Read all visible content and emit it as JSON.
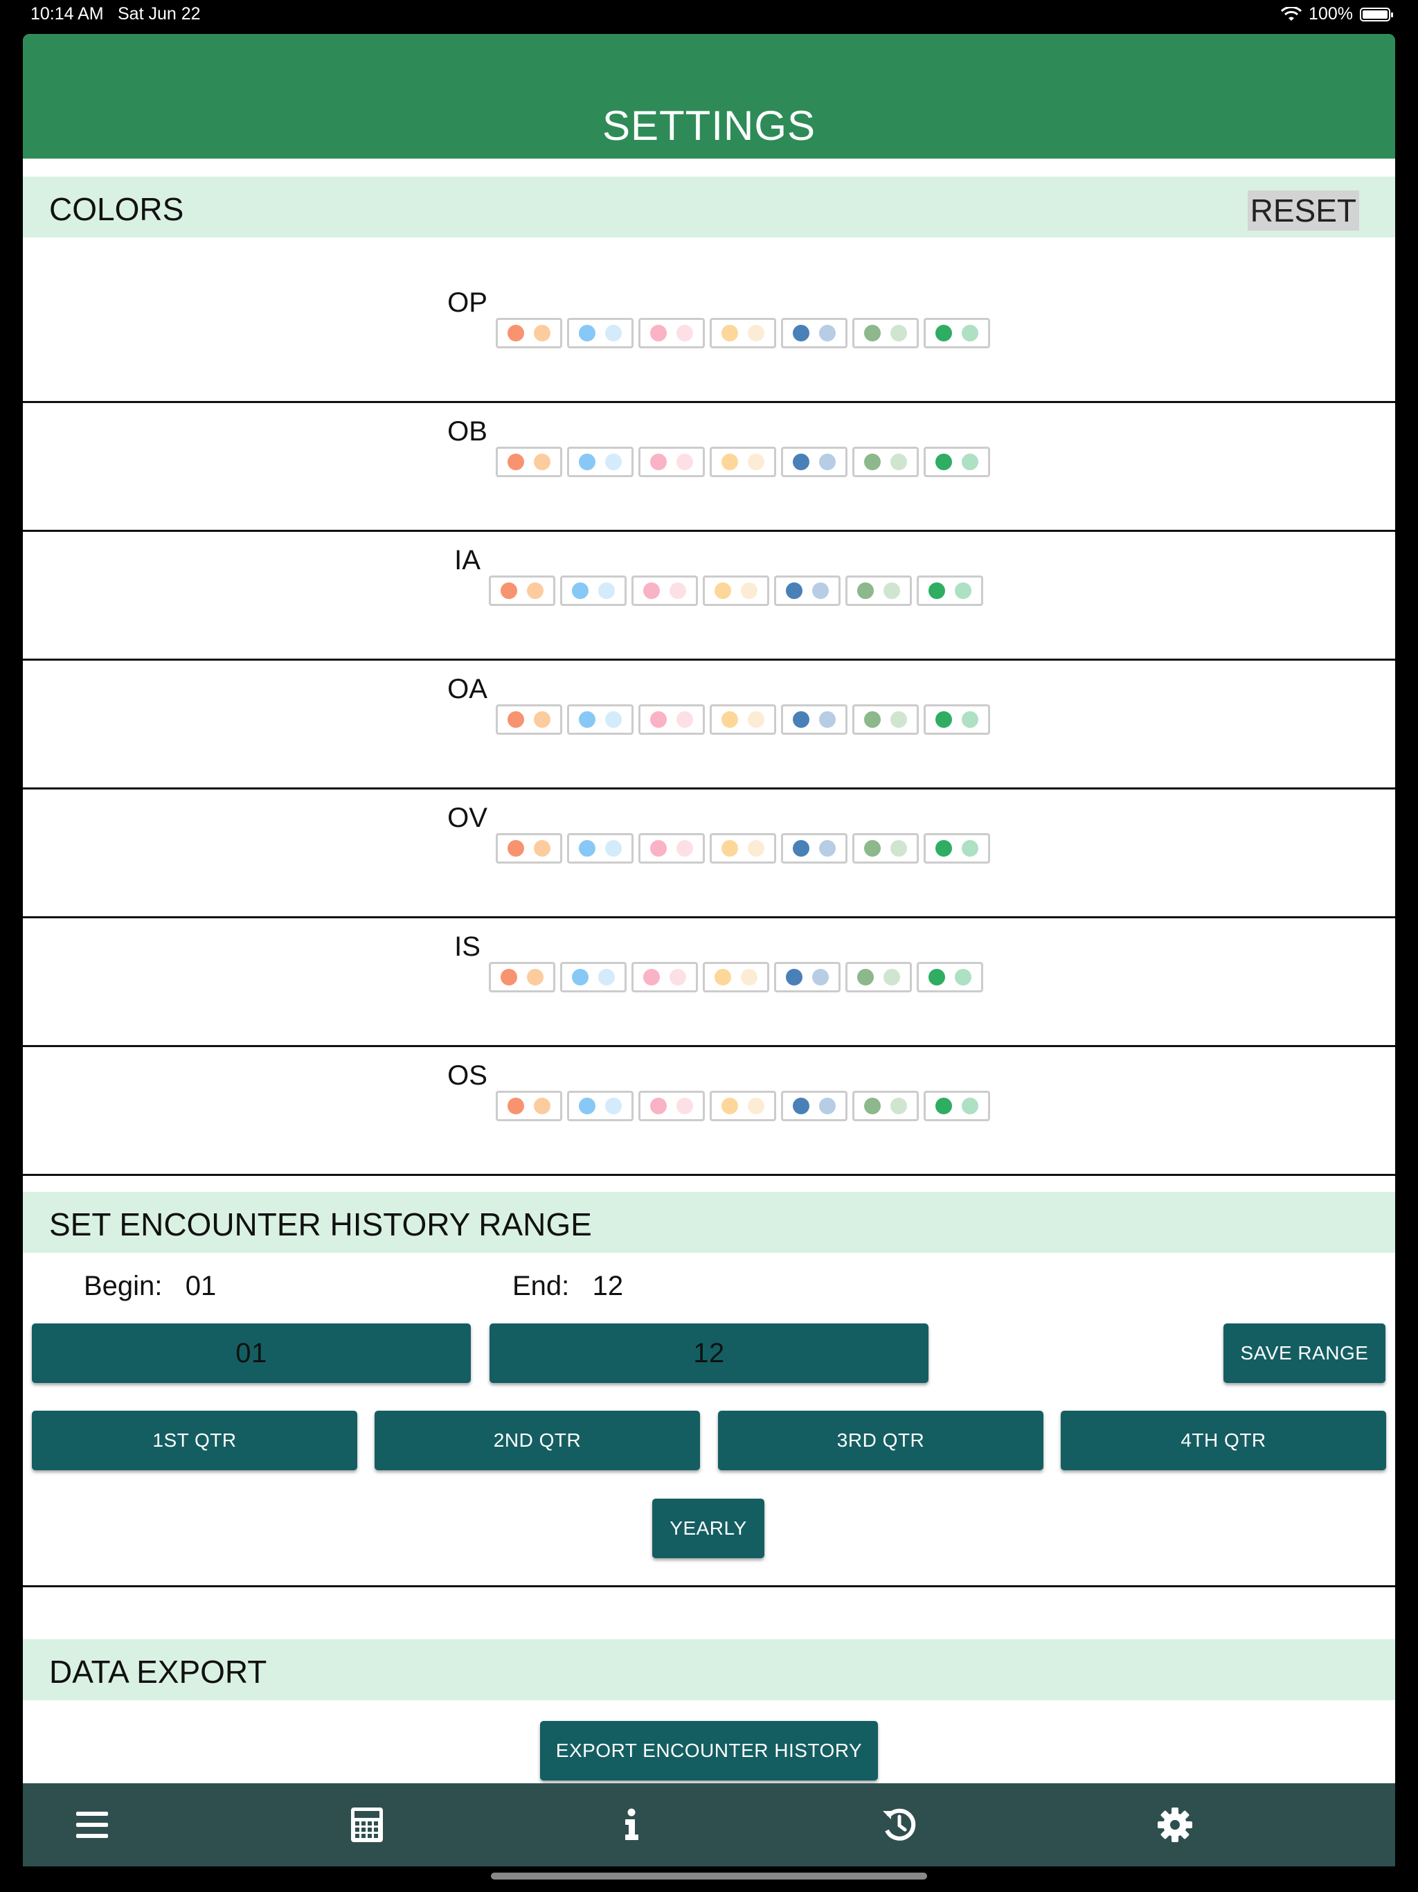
{
  "status": {
    "time": "10:14 AM",
    "date": "Sat Jun 22",
    "battery": "100%"
  },
  "header": {
    "title": "SETTINGS"
  },
  "colors": {
    "title": "COLORS",
    "reset_label": "RESET",
    "rows": [
      {
        "label": "OP"
      },
      {
        "label": "OB"
      },
      {
        "label": "IA"
      },
      {
        "label": "OA"
      },
      {
        "label": "OV"
      },
      {
        "label": "IS"
      },
      {
        "label": "OS"
      }
    ],
    "palette": [
      [
        "#f89370",
        "#fdcc9e"
      ],
      [
        "#87c8f6",
        "#d4ebfb"
      ],
      [
        "#f9b3c4",
        "#fde0e6"
      ],
      [
        "#fdd79a",
        "#fdecd5"
      ],
      [
        "#4a80b8",
        "#b7cde5"
      ],
      [
        "#8cb88b",
        "#cfe5cf"
      ],
      [
        "#2fad62",
        "#aee0c3"
      ]
    ]
  },
  "history": {
    "title": "SET ENCOUNTER HISTORY RANGE",
    "begin_label": "Begin:",
    "begin_value": "01",
    "end_label": "End:",
    "end_value": "12",
    "begin_picker": "01",
    "end_picker": "12",
    "save_label": "SAVE RANGE",
    "quarters": [
      "1ST QTR",
      "2ND QTR",
      "3RD QTR",
      "4TH QTR"
    ],
    "yearly_label": "YEARLY"
  },
  "export": {
    "title": "DATA EXPORT",
    "button_label": "EXPORT ENCOUNTER HISTORY"
  },
  "tabs": [
    "menu-icon",
    "calculator-icon",
    "info-icon",
    "history-icon",
    "gear-icon"
  ]
}
